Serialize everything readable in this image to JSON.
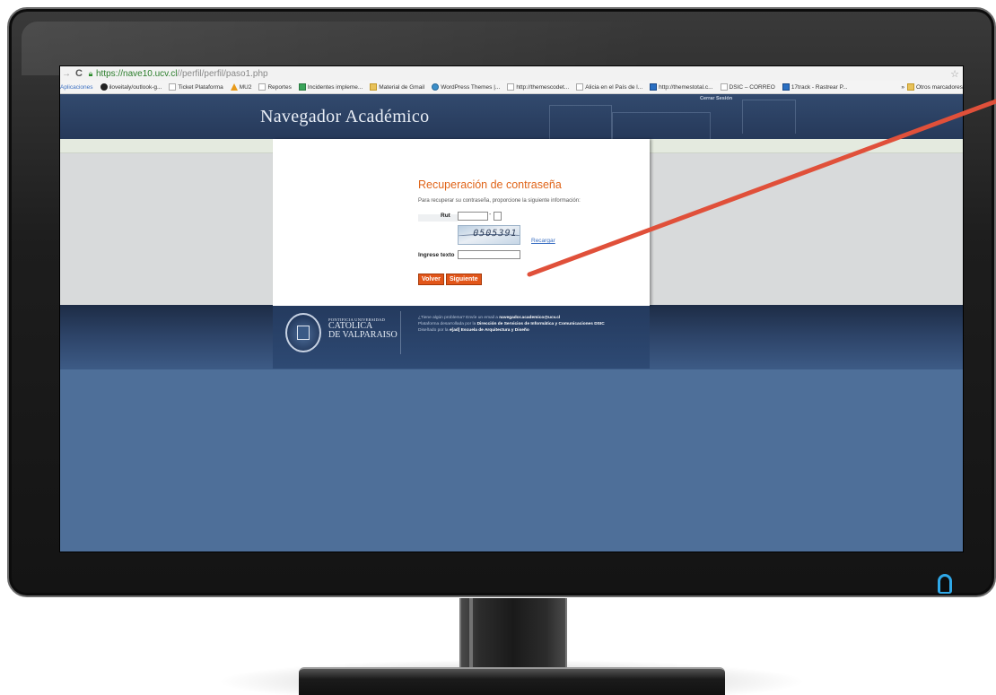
{
  "browser": {
    "url_host": "https://nave10.ucv.cl",
    "url_path": "//perfil/perfil/paso1.php",
    "bookmarks": [
      "Aplicaciones",
      "iloveitaly/outlook-g...",
      "Ticket Plataforma",
      "MU2",
      "Reportes",
      "Incidentes impleme...",
      "Material de Gmail",
      "WordPress Themes |...",
      "http://themescodet...",
      "Alicia en el País de l...",
      "http://themestotal.c...",
      "DSIC – CORREO",
      "17track - Rastrear P..."
    ],
    "other_bookmarks": "Otros marcadores"
  },
  "header": {
    "title": "Navegador Académico",
    "logout": "Cerrar Sesión"
  },
  "form": {
    "title": "Recuperación de contraseña",
    "intro": "Para recuperar su contraseña, proporcione la siguiente información:",
    "rut_label": "Rut",
    "rut_separator": "-",
    "captcha_text": "0505391",
    "reload_label": "Recargar",
    "text_label": "Ingrese texto",
    "back_button": "Volver",
    "next_button": "Siguiente"
  },
  "footer": {
    "univ_small": "PONTIFICIA UNIVERSIDAD",
    "univ_line1": "CATOLICA",
    "univ_line2": "DE VALPARAISO",
    "line1_text": "¿Tiene algún problema? Envíe un email a ",
    "line1_email": "navegador.academico@ucv.cl",
    "line2_text": "Plataforma desarrollada por la ",
    "line2_bold": "Dirección de Servicios de Informática y Comunicaciones DSIC",
    "line3_text": "Diseñado por la ",
    "line3_bold": "e[ad] Escuela de Arquitectura y Diseño"
  },
  "colors": {
    "accent_orange": "#e2561a",
    "annotation_arrow": "#e0503a",
    "header_navy": "#26395a",
    "power_led": "#2fa8e8"
  }
}
